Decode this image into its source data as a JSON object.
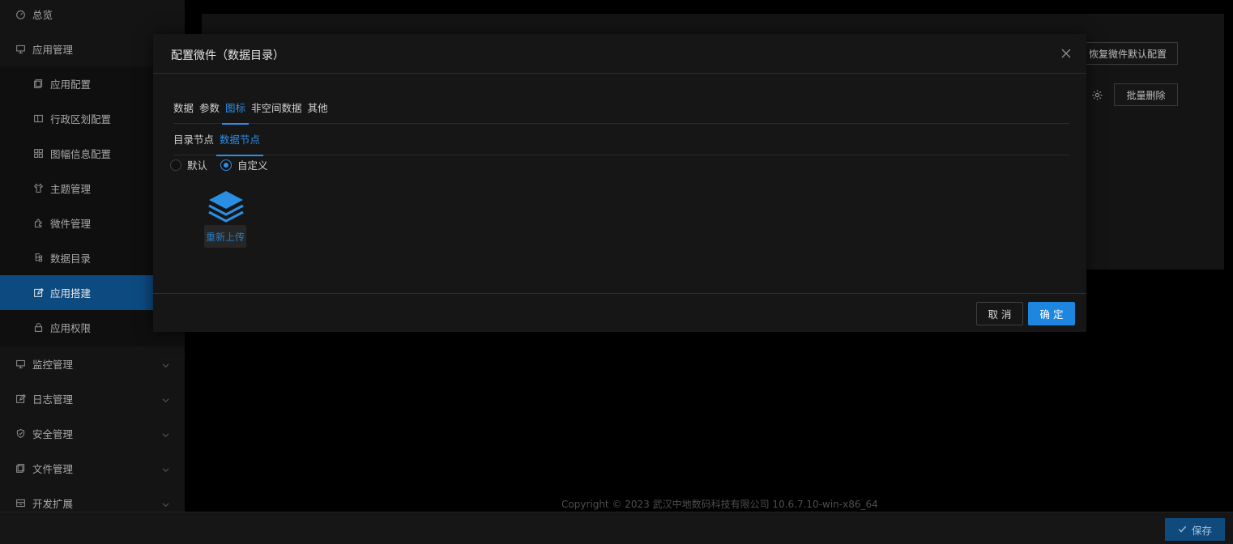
{
  "sidebar": {
    "items": [
      {
        "label": "总览",
        "icon": "dashboard-icon",
        "level": "top"
      },
      {
        "label": "应用管理",
        "icon": "monitor-icon",
        "level": "top"
      },
      {
        "label": "应用配置",
        "icon": "copy-icon",
        "level": "sub"
      },
      {
        "label": "行政区划配置",
        "icon": "panel-icon",
        "level": "sub"
      },
      {
        "label": "图幅信息配置",
        "icon": "grid-icon",
        "level": "sub"
      },
      {
        "label": "主题管理",
        "icon": "shirt-icon",
        "level": "sub"
      },
      {
        "label": "微件管理",
        "icon": "puzzle-icon",
        "level": "sub"
      },
      {
        "label": "数据目录",
        "icon": "tree-icon",
        "level": "sub"
      },
      {
        "label": "应用搭建",
        "icon": "edit-icon",
        "level": "sub",
        "active": true
      },
      {
        "label": "应用权限",
        "icon": "lock-icon",
        "level": "sub"
      },
      {
        "label": "监控管理",
        "icon": "monitor-icon",
        "level": "top"
      },
      {
        "label": "日志管理",
        "icon": "edit-icon",
        "level": "top"
      },
      {
        "label": "安全管理",
        "icon": "shield-icon",
        "level": "top"
      },
      {
        "label": "文件管理",
        "icon": "copy-icon",
        "level": "top"
      },
      {
        "label": "开发扩展",
        "icon": "box-icon",
        "level": "top"
      }
    ]
  },
  "main": {
    "restore_label": "恢复微件默认配置",
    "batch_delete_label": "批量删除",
    "copyright": "Copyright © 2023 武汉中地数码科技有限公司 10.6.7.10-win-x86_64",
    "save_label": "保存"
  },
  "modal": {
    "title": "配置微件（数据目录）",
    "tabs": [
      "数据",
      "参数",
      "图标",
      "非空间数据",
      "其他"
    ],
    "subtabs": [
      "目录节点",
      "数据节点"
    ],
    "radio_options": [
      "默认",
      "自定义"
    ],
    "upload_label": "重新上传",
    "cancel_label": "取 消",
    "ok_label": "确 定"
  },
  "colors": {
    "accent": "#1f86e0",
    "active_nav": "#0d4a80",
    "background": "#000000",
    "panel": "#161616"
  }
}
